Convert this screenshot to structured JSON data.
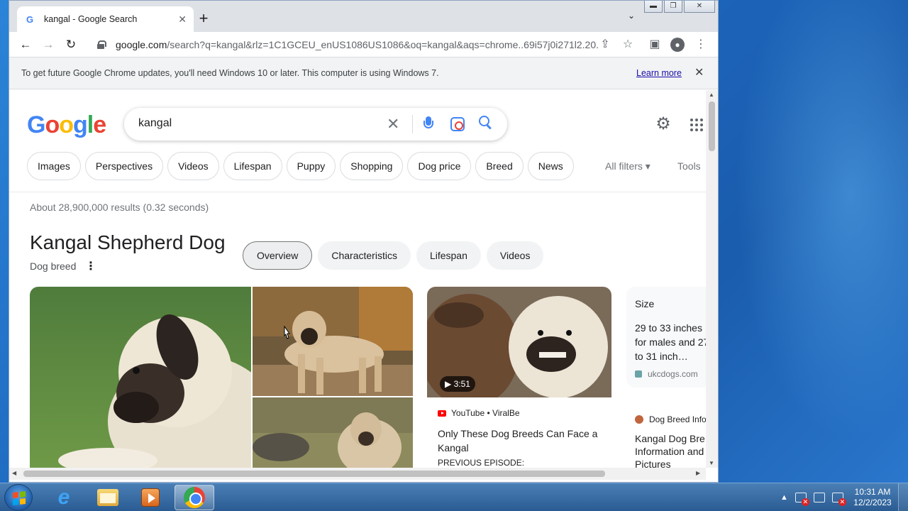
{
  "browser": {
    "tab_title": "kangal - Google Search",
    "favicon": "G",
    "url_host": "google.com",
    "url_rest": "/search?q=kangal&rlz=1C1GCEU_enUS1086US1086&oq=kangal&aqs=chrome..69i57j0i271l2.20...",
    "infobar_text": "To get future Google Chrome updates, you'll need Windows 10 or later. This computer is using Windows 7.",
    "infobar_link": "Learn more"
  },
  "search": {
    "logo_letters": [
      "G",
      "o",
      "o",
      "g",
      "l",
      "e"
    ],
    "query": "kangal",
    "chips": [
      "Images",
      "Perspectives",
      "Videos",
      "Lifespan",
      "Puppy",
      "Shopping",
      "Dog price",
      "Breed",
      "News"
    ],
    "all_filters": "All filters ▾",
    "tools": "Tools",
    "stats": "About 28,900,000 results (0.32 seconds)"
  },
  "knowledge_panel": {
    "title": "Kangal Shepherd Dog",
    "subtitle": "Dog breed",
    "tabs": [
      "Overview",
      "Characteristics",
      "Lifespan",
      "Videos"
    ],
    "video": {
      "duration": "▶ 3:51",
      "source": "YouTube • ViralBe",
      "title": "Only These Dog Breeds Can Face a Kangal",
      "snippet": "PREVIOUS EPISODE:"
    },
    "size_card": {
      "label": "Size",
      "value": "29 to 33 inches for males and 27 to 31 inch…",
      "source": "ukcdogs.com"
    },
    "info_card": {
      "source": "Dog Breed Info",
      "title": "Kangal Dog Bre Information and Pictures"
    }
  },
  "taskbar": {
    "time": "10:31 AM",
    "date": "12/2/2023"
  },
  "colors": {
    "google_blue": "#4285f4",
    "google_red": "#ea4335",
    "google_yellow": "#fbbc05",
    "google_green": "#34a853"
  }
}
